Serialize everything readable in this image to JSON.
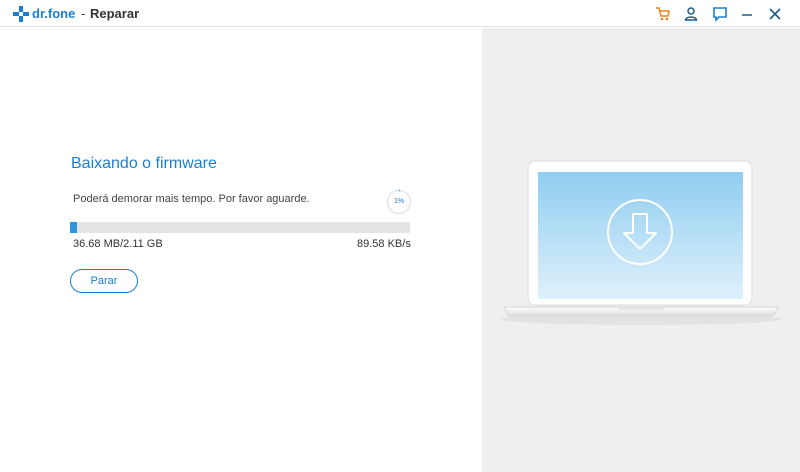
{
  "app": {
    "brand": "dr.fone",
    "separator": "-",
    "title": "Reparar"
  },
  "toolbar": {
    "icons": [
      "cart-icon",
      "user-icon",
      "feedback-icon",
      "minimize-icon",
      "close-icon"
    ],
    "cart_color": "#f0821c",
    "accent": "#1a7fd4"
  },
  "download": {
    "heading": "Baixando o firmware",
    "message": "Poderá demorar mais tempo. Por favor aguarde.",
    "percent_label": "1%",
    "progress": 0.02,
    "size": "36.68 MB/2.11 GB",
    "speed": "89.58 KB/s",
    "stop_label": "Parar"
  },
  "illustration": {
    "icon": "download-icon",
    "screen_top": "#8fcdf0",
    "screen_bottom": "#dff1fc"
  }
}
